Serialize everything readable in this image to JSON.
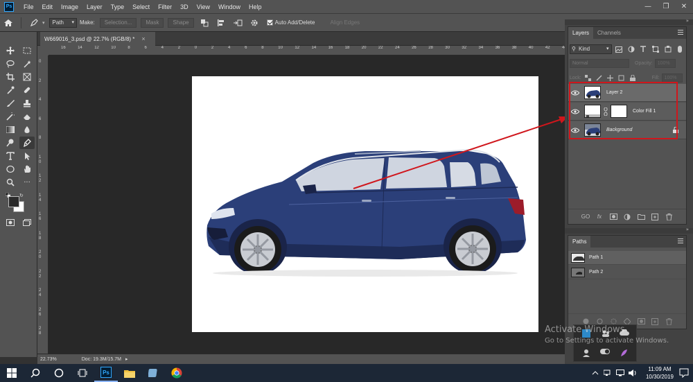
{
  "app": {
    "logo": "Ps"
  },
  "menu": [
    "File",
    "Edit",
    "Image",
    "Layer",
    "Type",
    "Select",
    "Filter",
    "3D",
    "View",
    "Window",
    "Help"
  ],
  "options": {
    "mode": "Path",
    "make_label": "Make:",
    "selection_btn": "Selection...",
    "mask_btn": "Mask",
    "shape_btn": "Shape",
    "auto_add_delete": "Auto Add/Delete",
    "align_edges": "Align Edges"
  },
  "document": {
    "tab_title": "W669016_3.psd @ 22.7% (RGB/8) *",
    "close": "×"
  },
  "ruler": {
    "h_ticks": [
      "16",
      "14",
      "12",
      "10",
      "8",
      "6",
      "4",
      "2",
      "0",
      "2",
      "4",
      "6",
      "8",
      "10",
      "12",
      "14",
      "16",
      "18",
      "20",
      "22",
      "24",
      "26",
      "28",
      "30",
      "32",
      "34",
      "36",
      "38",
      "40",
      "42",
      "44"
    ],
    "v_ticks": [
      "0",
      "2",
      "4",
      "6",
      "8",
      "1 0",
      "1 2",
      "1 4",
      "1 6",
      "1 8",
      "2 0",
      "2 2",
      "2 4",
      "2 6",
      "2 8"
    ]
  },
  "status": {
    "zoom": "22.73%",
    "doc": "Doc: 19.3M/15.7M"
  },
  "layers_panel": {
    "tabs": [
      "Layers",
      "Channels"
    ],
    "kind": "Kind",
    "blend": "Normal",
    "opacity_label": "Opacity:",
    "opacity_value": "100%",
    "lock_label": "Lock:",
    "fill_label": "Fill:",
    "fill_value": "100%",
    "layers": [
      {
        "name": "Layer 2"
      },
      {
        "name": "Color Fill 1"
      },
      {
        "name": "Background"
      }
    ],
    "footer": [
      "GO",
      "fx"
    ]
  },
  "paths_panel": {
    "title": "Paths",
    "paths": [
      {
        "name": "Path 1"
      },
      {
        "name": "Path 2"
      }
    ]
  },
  "watermark": {
    "line1": "Activate Windows",
    "line2": "Go to Settings to activate Windows."
  },
  "taskbar": {
    "time": "11:09 AM",
    "date": "10/30/2019",
    "ps": "Ps"
  },
  "colors": {
    "highlight": "#d0161c",
    "car": "#2a3f78",
    "ps_blue": "#31a8ff"
  }
}
